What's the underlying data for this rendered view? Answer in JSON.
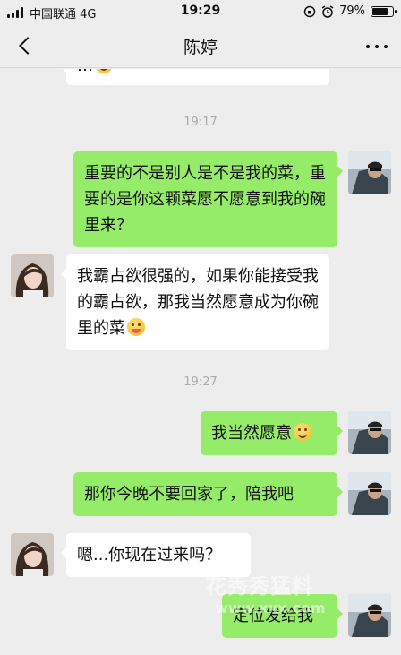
{
  "status_bar": {
    "carrier": "中国联通",
    "network": "4G",
    "time": "19:29",
    "battery": "79%",
    "battery_level": 0.79
  },
  "nav": {
    "title": "陈婷"
  },
  "chat": {
    "partial_top_text": "…",
    "timestamps": [
      "19:17",
      "19:27"
    ],
    "messages": [
      {
        "side": "out",
        "text": "重要的不是别人是不是我的菜，重要的是你这颗菜愿不愿意到我的碗里来？"
      },
      {
        "side": "in",
        "text": "我霸占欲很强的，如果你能接受我的霸占欲，那我当然愿意成为你碗里的菜"
      },
      {
        "side": "out",
        "text": "我当然愿意"
      },
      {
        "side": "out",
        "text": "那你今晚不要回家了，陪我吧"
      },
      {
        "side": "in",
        "text": "嗯...你现在过来吗？"
      },
      {
        "side": "out",
        "text": "定位发给我"
      }
    ]
  },
  "watermark": {
    "line1": "花秀秀猛料",
    "line2": "www.xxx.com"
  }
}
